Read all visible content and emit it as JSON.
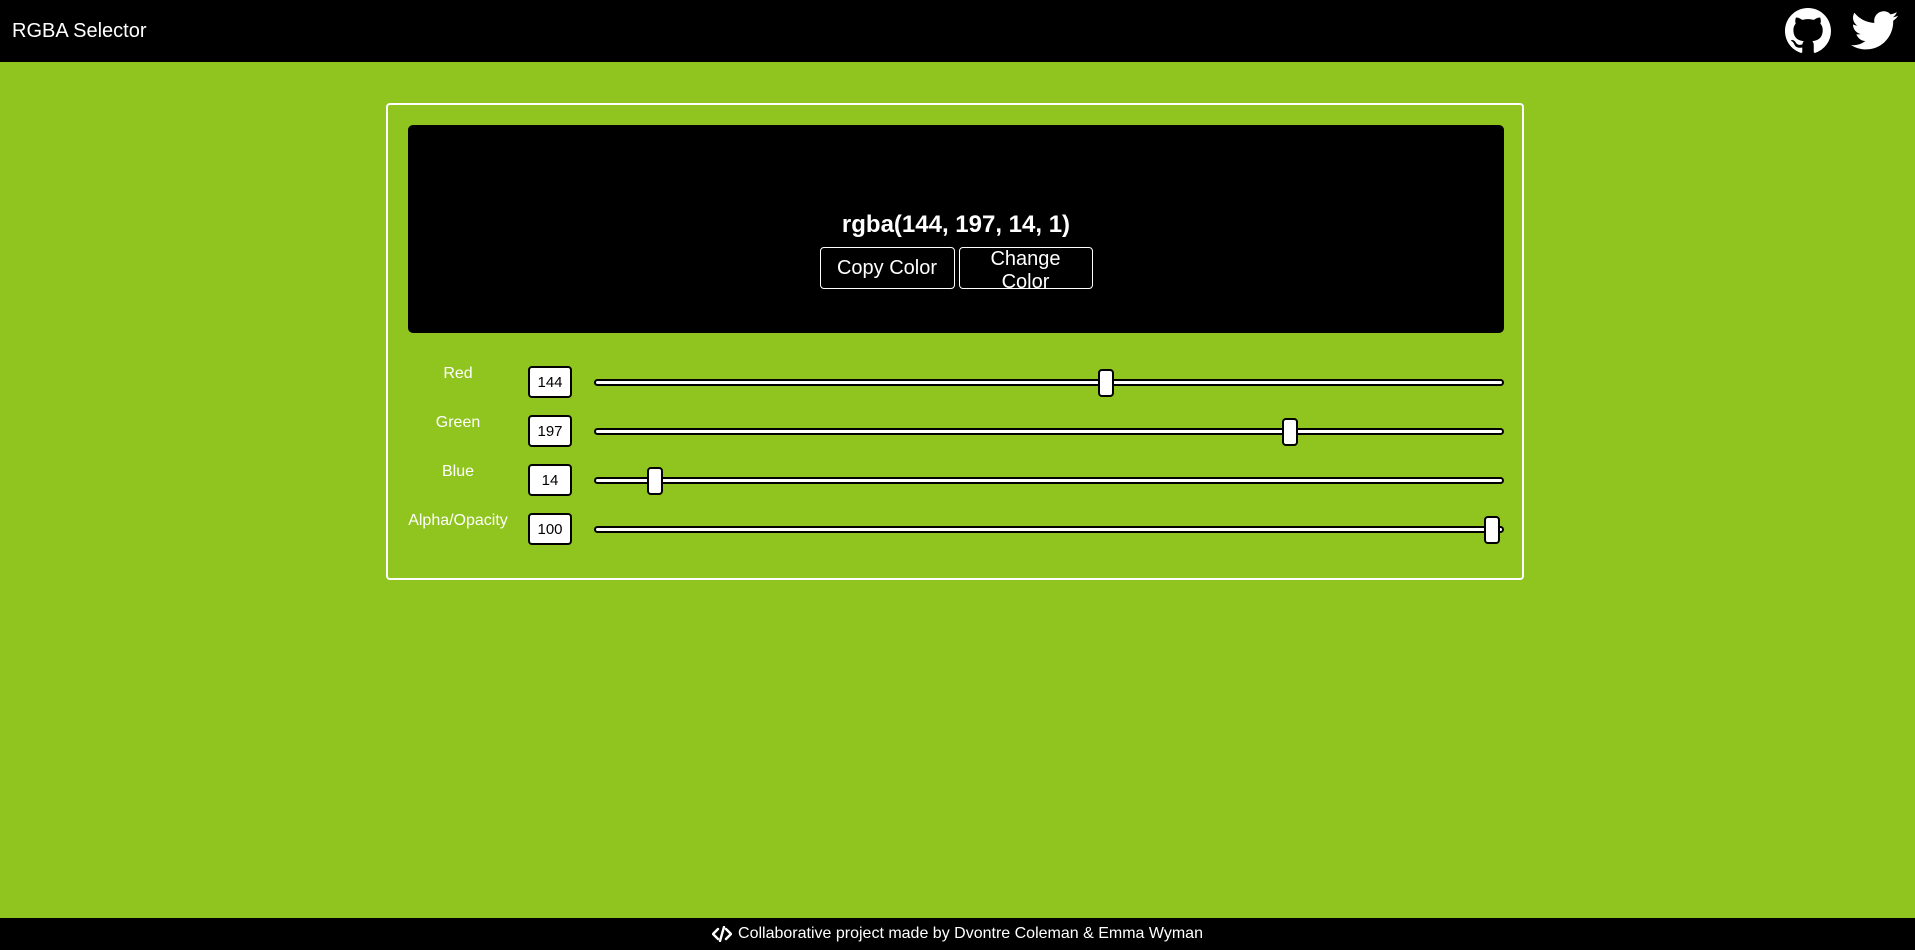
{
  "header": {
    "brand": "RGBA Selector",
    "icons": [
      "github-icon",
      "twitter-icon"
    ]
  },
  "preview": {
    "rgba_text": "rgba(144, 197, 14, 1)",
    "copy_label": "Copy Color",
    "change_label": "Change Color",
    "background_color": "#000000"
  },
  "sliders": [
    {
      "label": "Red",
      "value": "144",
      "min": 0,
      "max": 255
    },
    {
      "label": "Green",
      "value": "197",
      "min": 0,
      "max": 255
    },
    {
      "label": "Blue",
      "value": "14",
      "min": 0,
      "max": 255
    },
    {
      "label": "Alpha/Opacity",
      "value": "100",
      "min": 0,
      "max": 100
    }
  ],
  "footer": {
    "text": "Collaborative project made by Dvontre Coleman & Emma Wyman",
    "icon": "code-icon"
  },
  "colors": {
    "page_background": "#90c51f",
    "bar_background": "#000000"
  }
}
